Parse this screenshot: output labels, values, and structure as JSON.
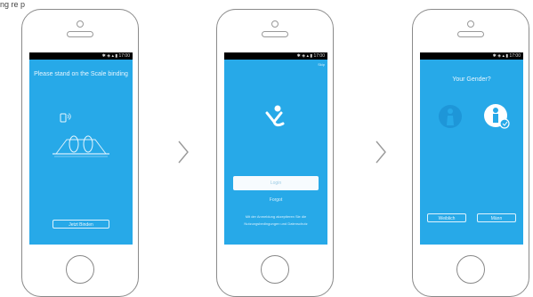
{
  "fragment_text": "ng re p",
  "phones": [
    {
      "status": "✱ ◈ ▴ ▮ 17:00",
      "title": "Please stand on the Scale binding",
      "button_label": "Jetzt Binden",
      "icon_names": [
        "phone-wave-icon",
        "scale-feet-icon"
      ]
    },
    {
      "status": "✱ ◈ ▴ ▮ 17:00",
      "skip_label": "Skip",
      "input_placeholder": "Login",
      "link_label": "Forgot",
      "footer_lines": [
        "Mit der Anmeldung akzeptieren Sie die",
        "Nutzungsbedingungen und Datenschutz"
      ],
      "icon_names": [
        "app-logo-icon"
      ]
    },
    {
      "status": "✱ ◈ ▴ ▮ 17:00",
      "title": "Your Gender?",
      "left_button": "Weiblich",
      "right_button": "Männ",
      "icon_names": [
        "female-gender-icon",
        "male-gender-icon"
      ]
    }
  ],
  "colors": {
    "screen": "#27a9e8",
    "statusbar": "#000000",
    "frame": "#8a8a8a"
  },
  "icons": {
    "separator": "chevron-right-icon"
  }
}
